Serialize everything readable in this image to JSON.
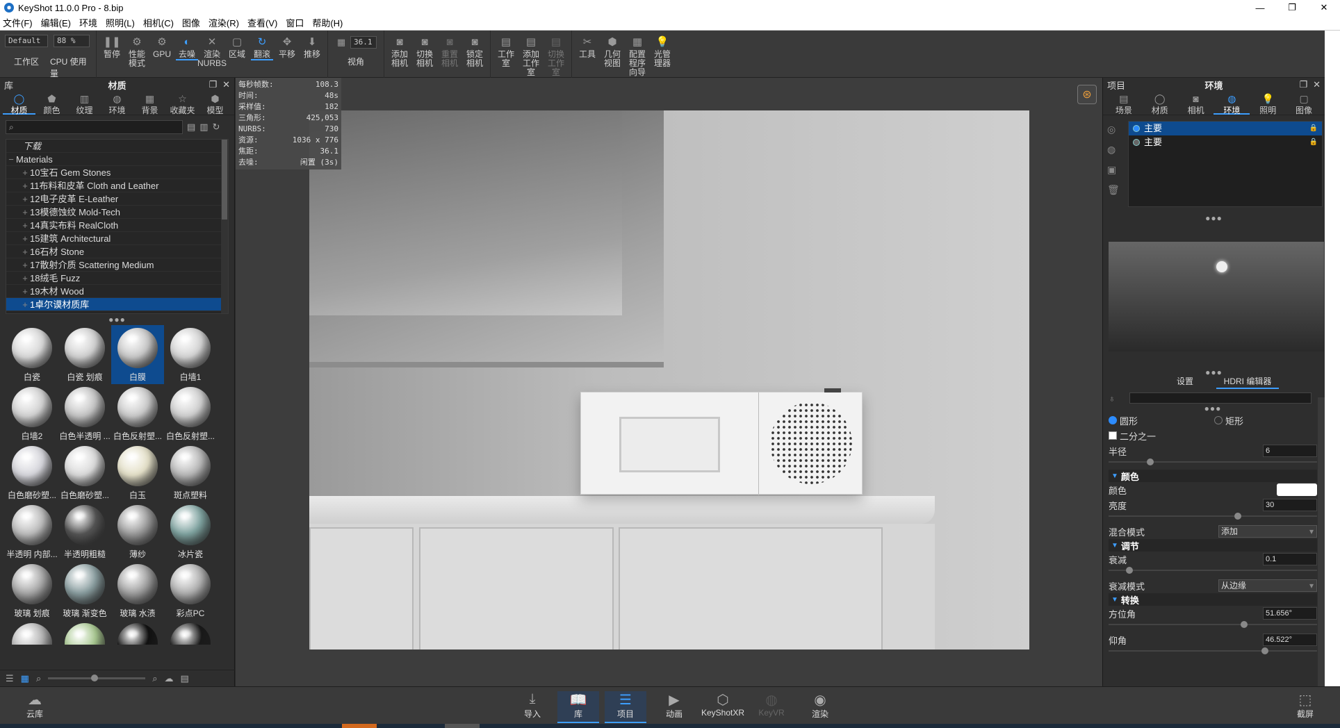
{
  "window": {
    "title": "KeyShot 11.0.0 Pro  - 8.bip",
    "minimize": "—",
    "maximize": "❐",
    "close": "✕"
  },
  "menu": [
    "文件(F)",
    "编辑(E)",
    "环境",
    "照明(L)",
    "相机(C)",
    "图像",
    "渲染(R)",
    "查看(V)",
    "窗口",
    "帮助(H)"
  ],
  "toolbar": {
    "workspace_value": "Default",
    "workspace_label": "工作区",
    "cpu_value": "88 %",
    "cpu_label": "CPU 使用量",
    "buttons": [
      {
        "label": "暂停",
        "icon": "pause-icon"
      },
      {
        "label": "性能模式",
        "icon": "performance-icon"
      },
      {
        "label": "GPU",
        "icon": "gpu-icon"
      },
      {
        "label": "去噪",
        "icon": "denoise-icon",
        "active": true
      },
      {
        "label": "渲染 NURBS",
        "icon": "nurbs-icon"
      },
      {
        "label": "区域",
        "icon": "region-icon"
      },
      {
        "label": "翻滚",
        "icon": "tumble-icon",
        "active": true
      },
      {
        "label": "平移",
        "icon": "pan-icon"
      },
      {
        "label": "推移",
        "icon": "dolly-icon"
      }
    ],
    "fov_value": "36.1",
    "fov_label": "视角",
    "camera_buttons": [
      {
        "label": "添加相机",
        "icon": "add-camera-icon"
      },
      {
        "label": "切换相机",
        "icon": "switch-camera-icon"
      },
      {
        "label": "重置相机",
        "icon": "reset-camera-icon",
        "dim": true
      },
      {
        "label": "锁定相机",
        "icon": "lock-camera-icon"
      }
    ],
    "studio_buttons": [
      {
        "label": "工作室",
        "icon": "studio-icon"
      },
      {
        "label": "添加工作室",
        "icon": "add-studio-icon"
      },
      {
        "label": "切换工作室",
        "icon": "switch-studio-icon",
        "dim": true
      }
    ],
    "tool_buttons": [
      {
        "label": "工具",
        "icon": "tools-icon"
      },
      {
        "label": "几何视图",
        "icon": "geometry-view-icon"
      },
      {
        "label": "配置程序向导",
        "icon": "configurator-icon"
      },
      {
        "label": "光管理器",
        "icon": "light-manager-icon"
      }
    ]
  },
  "library": {
    "panel_title": "库",
    "active_title": "材质",
    "tabs": [
      "材质",
      "颜色",
      "纹理",
      "环境",
      "背景",
      "收藏夹",
      "模型"
    ],
    "search_placeholder": "",
    "tree": [
      {
        "label": "下载",
        "indent": 1
      },
      {
        "label": "Materials",
        "indent": 0
      },
      {
        "label": "10宝石 Gem Stones",
        "indent": 2
      },
      {
        "label": "11布料和皮革 Cloth and Leather",
        "indent": 2
      },
      {
        "label": "12电子皮革 E-Leather",
        "indent": 2
      },
      {
        "label": "13模德蚀纹 Mold-Tech",
        "indent": 2
      },
      {
        "label": "14真实布料 RealCloth",
        "indent": 2
      },
      {
        "label": "15建筑 Architectural",
        "indent": 2
      },
      {
        "label": "16石材 Stone",
        "indent": 2
      },
      {
        "label": "17散射介质 Scattering Medium",
        "indent": 2
      },
      {
        "label": "18绒毛 Fuzz",
        "indent": 2
      },
      {
        "label": "19木材 Wood",
        "indent": 2
      },
      {
        "label": "1卓尔谟材质库",
        "indent": 2,
        "selected": true
      }
    ],
    "materials": [
      {
        "name": "白瓷",
        "color": "#d8d8d8"
      },
      {
        "name": "白瓷 划痕",
        "color": "#d0d0d0"
      },
      {
        "name": "白膜",
        "color": "#c8c8c8",
        "selected": true
      },
      {
        "name": "白墙1",
        "color": "#d4d4d4"
      },
      {
        "name": "白墙2",
        "color": "#d2d2d2"
      },
      {
        "name": "白色半透明 ...",
        "color": "#c4c4c4"
      },
      {
        "name": "白色反射塑...",
        "color": "#cacaca"
      },
      {
        "name": "白色反射塑...",
        "color": "#cfcfcf"
      },
      {
        "name": "白色磨砂塑...",
        "color": "#d6d6dc"
      },
      {
        "name": "白色磨砂塑...",
        "color": "#dadada"
      },
      {
        "name": "白玉",
        "color": "#e4e0c8"
      },
      {
        "name": "斑点塑料",
        "color": "#b8b8b8"
      },
      {
        "name": "半透明 内部...",
        "color": "#bcbcbc"
      },
      {
        "name": "半透明粗糙",
        "color": "#555555"
      },
      {
        "name": "薄纱",
        "color": "#9a9a9a"
      },
      {
        "name": "冰片瓷",
        "color": "#7fa3a0"
      },
      {
        "name": "玻璃 划痕",
        "color": "#a8a8a8"
      },
      {
        "name": "玻璃 渐变色",
        "color": "#8a9ea0"
      },
      {
        "name": "玻璃 水渍",
        "color": "#a0a0a0"
      },
      {
        "name": "彩点PC",
        "color": "#b0b0b0"
      },
      {
        "name": "",
        "color": "#b4b4b4"
      },
      {
        "name": "",
        "color": "#a8c890"
      },
      {
        "name": "",
        "color": "#111111"
      },
      {
        "name": "",
        "color": "#1a1a1a"
      }
    ]
  },
  "stats": [
    {
      "k": "每秒帧数:",
      "v": "108.3"
    },
    {
      "k": "时间:",
      "v": "48s"
    },
    {
      "k": "采样值:",
      "v": "182"
    },
    {
      "k": "三角形:",
      "v": "425,053"
    },
    {
      "k": "NURBS:",
      "v": "730"
    },
    {
      "k": "资源:",
      "v": "1036 x 776"
    },
    {
      "k": "焦距:",
      "v": "36.1"
    },
    {
      "k": "去噪:",
      "v": "闲置 (3s)"
    }
  ],
  "project": {
    "panel_title": "项目",
    "active_title": "环境",
    "tabs": [
      "场景",
      "材质",
      "相机",
      "环境",
      "照明",
      "图像"
    ],
    "env_list": [
      {
        "label": "主要",
        "selected": true
      },
      {
        "label": "主要",
        "selected": false
      }
    ],
    "subtabs": [
      "设置",
      "HDRI 编辑器"
    ],
    "shape_circle": "圆形",
    "shape_rect": "矩形",
    "half": "二分之一",
    "radius_label": "半径",
    "radius_value": "6",
    "radius_pos": 0.2,
    "section_color": "颜色",
    "color_label": "颜色",
    "brightness_label": "亮度",
    "brightness_value": "30",
    "brightness_pos": 0.62,
    "blend_label": "混合模式",
    "blend_value": "添加",
    "section_adjust": "调节",
    "falloff_label": "衰减",
    "falloff_value": "0.1",
    "falloff_pos": 0.1,
    "falloff_mode_label": "衰减模式",
    "falloff_mode_value": "从边缘",
    "section_transform": "转换",
    "azimuth_label": "方位角",
    "azimuth_value": "51.656°",
    "azimuth_pos": 0.65,
    "elevation_label": "仰角",
    "elevation_value": "46.522°",
    "elevation_pos": 0.75
  },
  "bottom": [
    {
      "label": "云库",
      "icon": "cloud-library-icon"
    },
    {
      "label": "导入",
      "icon": "import-icon"
    },
    {
      "label": "库",
      "icon": "library-icon",
      "active": true
    },
    {
      "label": "项目",
      "icon": "project-icon",
      "active": true
    },
    {
      "label": "动画",
      "icon": "animation-icon"
    },
    {
      "label": "KeyShotXR",
      "icon": "keyshotxr-icon"
    },
    {
      "label": "KeyVR",
      "icon": "keyvr-icon",
      "dim": true
    },
    {
      "label": "渲染",
      "icon": "render-icon"
    },
    {
      "label": "截屏",
      "icon": "screenshot-icon"
    }
  ]
}
